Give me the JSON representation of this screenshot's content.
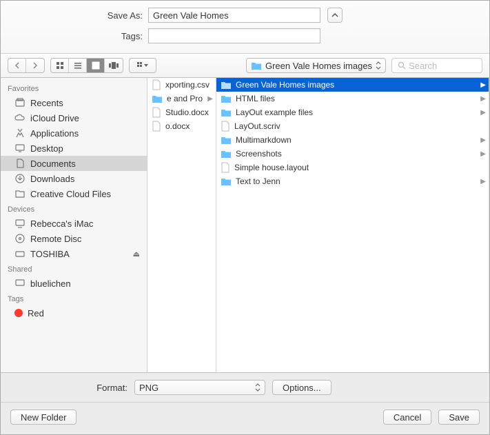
{
  "saveas": {
    "label": "Save As:",
    "value": "Green Vale Homes"
  },
  "tags": {
    "label": "Tags:",
    "value": ""
  },
  "path_dropdown": {
    "folder": "Green Vale Homes images"
  },
  "search": {
    "placeholder": "Search"
  },
  "sidebar": {
    "favorites": {
      "header": "Favorites",
      "items": [
        {
          "label": "Recents"
        },
        {
          "label": "iCloud Drive"
        },
        {
          "label": "Applications"
        },
        {
          "label": "Desktop"
        },
        {
          "label": "Documents"
        },
        {
          "label": "Downloads"
        },
        {
          "label": "Creative Cloud Files"
        }
      ]
    },
    "devices": {
      "header": "Devices",
      "items": [
        {
          "label": "Rebecca's iMac"
        },
        {
          "label": "Remote Disc"
        },
        {
          "label": "TOSHIBA"
        }
      ]
    },
    "shared": {
      "header": "Shared",
      "items": [
        {
          "label": "bluelichen"
        }
      ]
    },
    "tags": {
      "header": "Tags",
      "items": [
        {
          "label": "Red",
          "color": "#ff3b30"
        }
      ]
    }
  },
  "column1": [
    {
      "name": "xporting.csv",
      "type": "file"
    },
    {
      "name": "e and Pro",
      "type": "folder"
    },
    {
      "name": "Studio.docx",
      "type": "file"
    },
    {
      "name": "o.docx",
      "type": "file"
    }
  ],
  "column2": [
    {
      "name": "Green Vale Homes images",
      "type": "folder",
      "selected": true
    },
    {
      "name": "HTML files",
      "type": "folder"
    },
    {
      "name": "LayOut example files",
      "type": "folder"
    },
    {
      "name": "LayOut.scriv",
      "type": "file"
    },
    {
      "name": "Multimarkdown",
      "type": "folder"
    },
    {
      "name": "Screenshots",
      "type": "folder"
    },
    {
      "name": "Simple house.layout",
      "type": "file"
    },
    {
      "name": "Text to Jenn",
      "type": "folder"
    }
  ],
  "format": {
    "label": "Format:",
    "value": "PNG",
    "options_button": "Options..."
  },
  "buttons": {
    "new_folder": "New Folder",
    "cancel": "Cancel",
    "save": "Save"
  }
}
